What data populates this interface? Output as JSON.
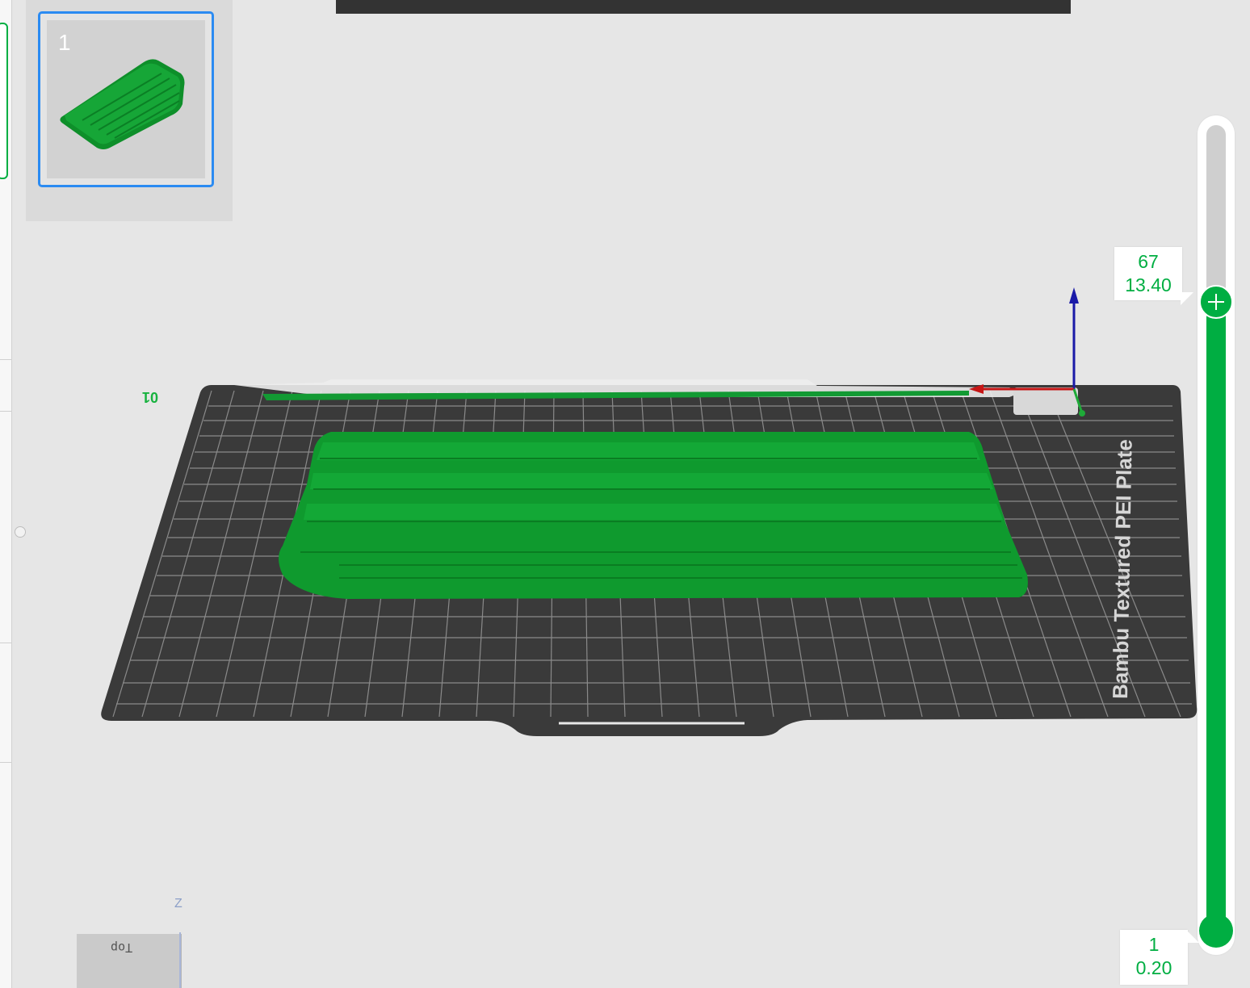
{
  "plate_list": {
    "plates": [
      {
        "number": "1",
        "selected": true
      }
    ]
  },
  "bed": {
    "plate_name": "Bambu Textured PEI Plate",
    "plate_index_label": "01"
  },
  "layer_slider": {
    "top_layer": "67",
    "top_height": "13.40",
    "bottom_layer": "1",
    "bottom_height": "0.20",
    "fill_color": "#00ae42"
  },
  "view_cube": {
    "face_label": "Top",
    "axis_label": "Z"
  },
  "colors": {
    "model": "#0f9a2e",
    "bed": "#3a3a3a",
    "accent": "#00ae42",
    "selection": "#2b8bf2"
  }
}
